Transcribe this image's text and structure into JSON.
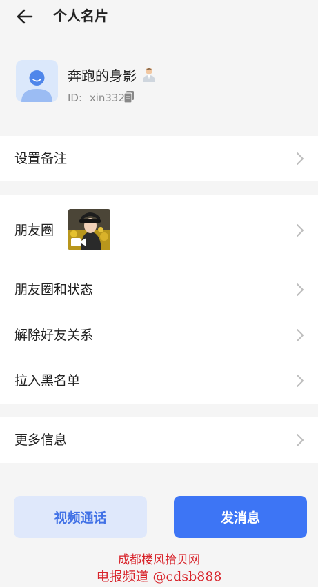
{
  "header": {
    "title": "个人名片"
  },
  "profile": {
    "nickname": "奔跑的身影",
    "id_label": "ID:",
    "id_value": "xin332"
  },
  "menu": {
    "remark": "设置备注",
    "moments": "朋友圈",
    "moments_status": "朋友圈和状态",
    "remove_friend": "解除好友关系",
    "blacklist": "拉入黑名单",
    "more_info": "更多信息"
  },
  "actions": {
    "video_call": "视频通话",
    "send_message": "发消息"
  },
  "watermark": {
    "line1": "成都楼风拾贝网",
    "line2": "电报频道 @cdsb888"
  },
  "colors": {
    "accent": "#3d75f5",
    "secondary_bg": "#dfe8fb",
    "secondary_text": "#4272e6",
    "page_bg": "#f5f5f5",
    "watermark": "#d8232a"
  },
  "icons": [
    "back-arrow-icon",
    "person-emoji-icon",
    "copy-icon",
    "chevron-right-icon",
    "video-camera-icon"
  ]
}
